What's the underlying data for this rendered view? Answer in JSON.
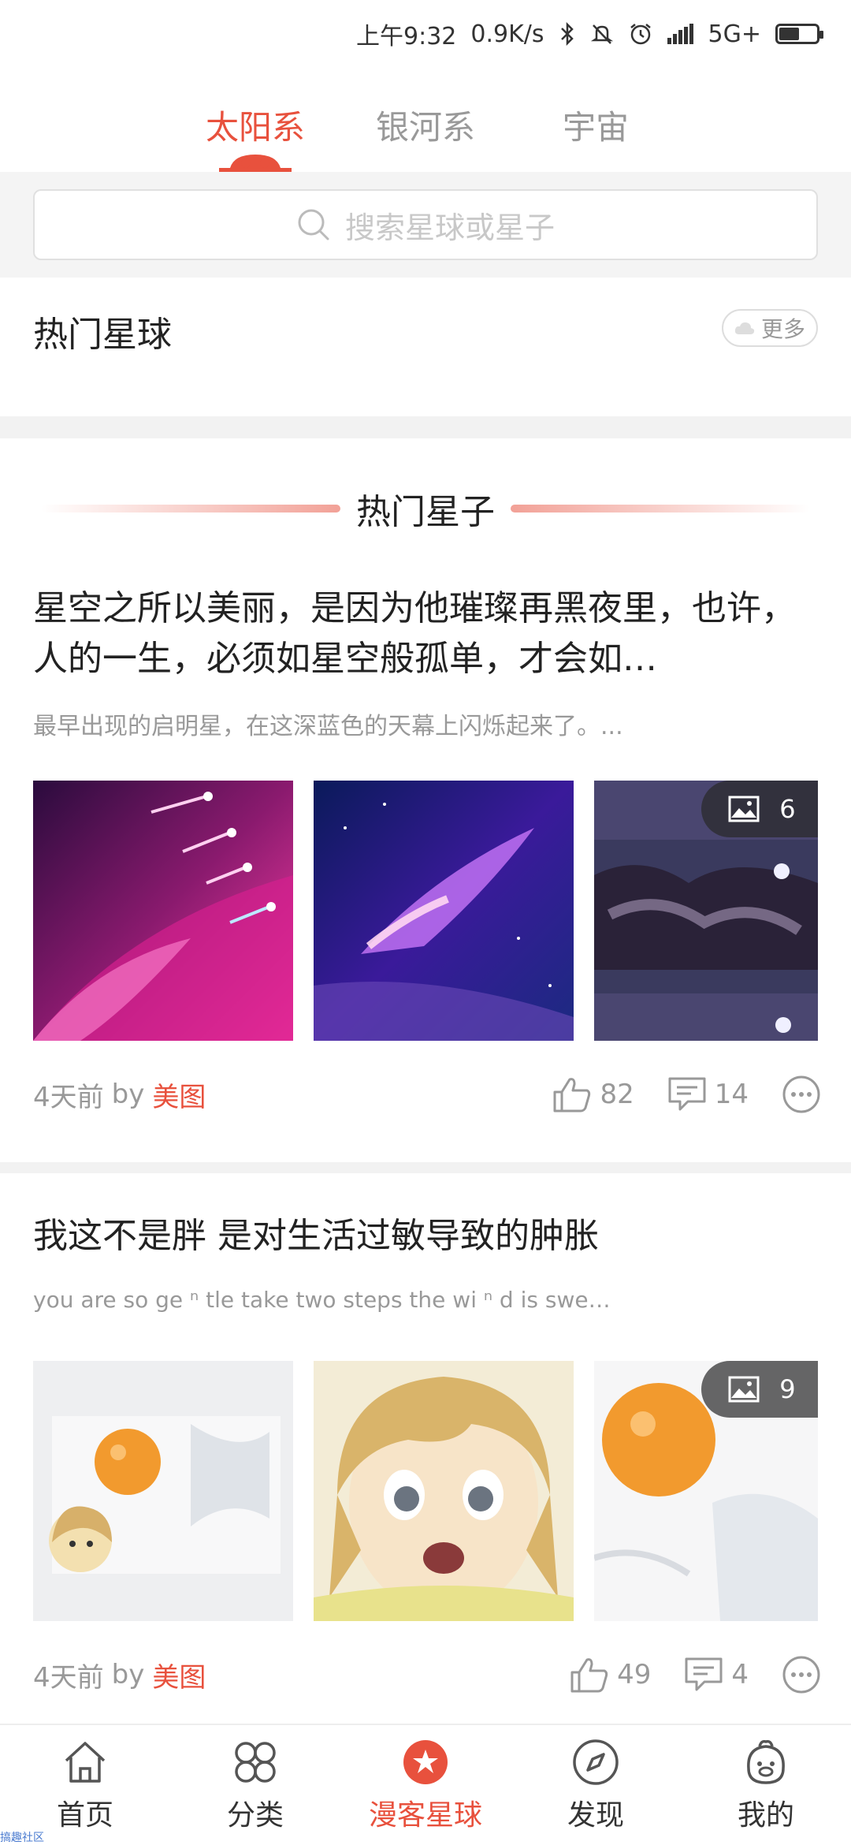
{
  "status_bar": {
    "time": "上午9:32",
    "speed": "0.9K/s",
    "network": "5G+",
    "battery_level": 0.55
  },
  "top_tabs": [
    {
      "label": "太阳系",
      "active": true
    },
    {
      "label": "银河系",
      "active": false
    },
    {
      "label": "宇宙",
      "active": false
    }
  ],
  "search": {
    "placeholder": "搜索星球或星子"
  },
  "hot_planets": {
    "title": "热门星球",
    "more_label": "更多"
  },
  "hot_posts_section": {
    "title": "热门星子"
  },
  "posts": [
    {
      "title": "星空之所以美丽，是因为他璀璨再黑夜里，也许，人的一生，必须如星空般孤单，才会如…",
      "description": "最早出现的启明星，在这深蓝色的天幕上闪烁起来了。...",
      "image_count": "6",
      "time": "4天前",
      "by": "by",
      "author": "美图",
      "likes": "82",
      "comments": "14"
    },
    {
      "title": "我这不是胖 是对生活过敏导致的肿胀",
      "description": "you are so ge ⁿ tle take two steps the wi ⁿ d is swe…",
      "image_count": "9",
      "time": "4天前",
      "by": "by",
      "author": "美图",
      "likes": "49",
      "comments": "4"
    }
  ],
  "bottom_nav": [
    {
      "label": "首页",
      "icon": "home-icon",
      "active": false
    },
    {
      "label": "分类",
      "icon": "category-icon",
      "active": false
    },
    {
      "label": "漫客星球",
      "icon": "planet-icon",
      "active": true
    },
    {
      "label": "发现",
      "icon": "compass-icon",
      "active": false
    },
    {
      "label": "我的",
      "icon": "profile-icon",
      "active": false
    }
  ],
  "watermark": "搞趣社区",
  "colors": {
    "accent": "#e8513d",
    "muted": "#999999",
    "band": "#f2f2f2"
  }
}
